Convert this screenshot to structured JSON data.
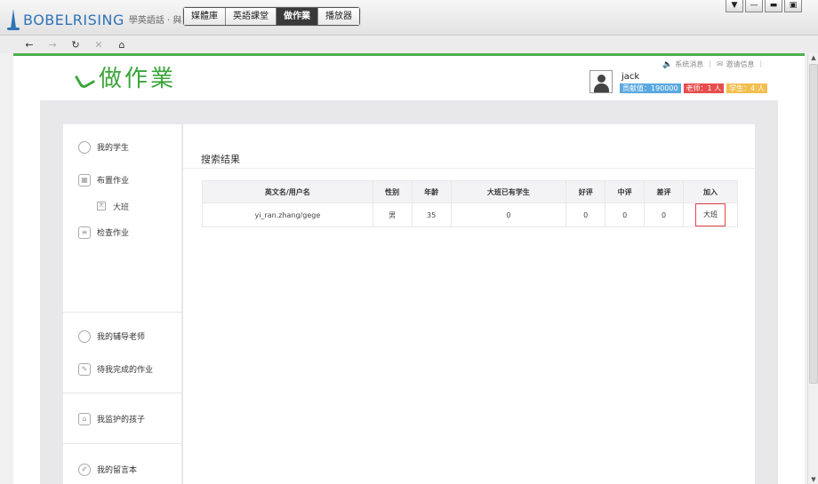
{
  "app": {
    "logo_text": "BOBELRISING",
    "logo_sub": "學英語話 · 與種！",
    "main_tabs": [
      {
        "label": "媒體庫",
        "active": false
      },
      {
        "label": "英語課堂",
        "active": false
      },
      {
        "label": "做作業",
        "active": true
      },
      {
        "label": "播放器",
        "active": false
      }
    ],
    "window_controls": [
      "▼",
      "—",
      "▬",
      "▣"
    ]
  },
  "nav": {
    "back": "←",
    "forward": "→",
    "refresh": "↻",
    "stop": "✕",
    "home": "⌂"
  },
  "header": {
    "brand_title": "做作業",
    "top_links": [
      {
        "icon": "speaker-icon",
        "label": "系统消息"
      },
      {
        "icon": "mail-icon",
        "label": "邀请信息"
      }
    ],
    "user": {
      "name": "jack",
      "badges": [
        {
          "label": "贡献值：190000",
          "color": "#5aa9e0"
        },
        {
          "label": "老师：1 人",
          "color": "#e84c4c"
        },
        {
          "label": "学生：4 人",
          "color": "#f3bf4f"
        }
      ]
    }
  },
  "sidebar": {
    "sections": [
      {
        "items": [
          {
            "label": "我的学生",
            "icon": "students-icon"
          },
          {
            "label": "布置作业",
            "icon": "assign-icon"
          },
          {
            "label": "大班",
            "icon": "class-icon",
            "sub": true
          },
          {
            "label": "检查作业",
            "icon": "check-icon"
          }
        ]
      },
      {
        "items": [
          {
            "label": "我的辅导老师",
            "icon": "tutor-icon"
          },
          {
            "label": "待我完成的作业",
            "icon": "todo-icon"
          }
        ]
      },
      {
        "items": [
          {
            "label": "我监护的孩子",
            "icon": "children-icon"
          }
        ]
      },
      {
        "items": [
          {
            "label": "我的留言本",
            "icon": "message-icon"
          }
        ]
      }
    ]
  },
  "main": {
    "title": "搜索结果",
    "table": {
      "headers": [
        "英文名/用户名",
        "性别",
        "年龄",
        "大班已有学生",
        "好评",
        "中评",
        "差评",
        "加入"
      ],
      "rows": [
        {
          "name": "yi_ran.zhang/gege",
          "gender": "男",
          "age": "35",
          "students": "0",
          "good": "0",
          "mid": "0",
          "bad": "0",
          "join": "大班"
        }
      ]
    }
  }
}
